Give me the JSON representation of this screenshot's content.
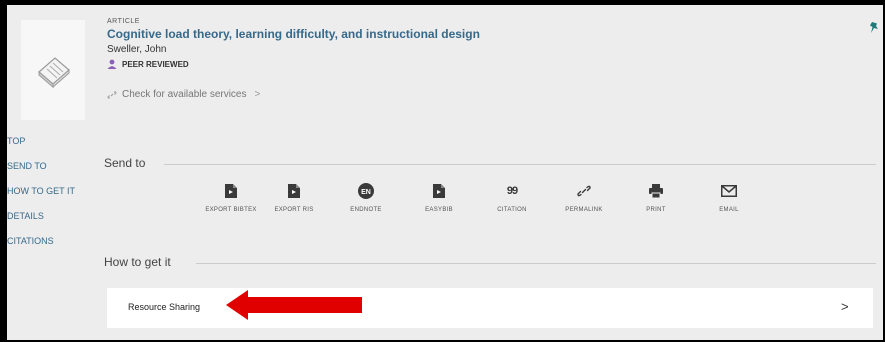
{
  "record": {
    "type": "ARTICLE",
    "title": "Cognitive load theory, learning difficulty, and instructional design",
    "author": "Sweller, John",
    "peer_reviewed": "PEER REVIEWED",
    "check_services": "Check for available services",
    "check_services_arrow": ">"
  },
  "sidenav": [
    "TOP",
    "SEND TO",
    "HOW TO GET IT",
    "DETAILS",
    "CITATIONS"
  ],
  "send_to": {
    "title": "Send to",
    "actions": [
      {
        "label": "EXPORT BIBTEX",
        "icon": "file-bibtex-icon"
      },
      {
        "label": "EXPORT RIS",
        "icon": "file-ris-icon"
      },
      {
        "label": "ENDNOTE",
        "icon": "endnote-icon",
        "badge": "EN"
      },
      {
        "label": "EASYBIB",
        "icon": "easybib-icon"
      },
      {
        "label": "CITATION",
        "icon": "quote-icon",
        "glyph": "99"
      },
      {
        "label": "PERMALINK",
        "icon": "link-icon"
      },
      {
        "label": "PRINT",
        "icon": "printer-icon"
      },
      {
        "label": "EMAIL",
        "icon": "envelope-icon"
      }
    ]
  },
  "how_to_get_it": {
    "title": "How to get it",
    "resource_sharing": "Resource Sharing",
    "chevron": ">"
  },
  "colors": {
    "link": "#37698a",
    "annotation_arrow": "#e00000",
    "background": "#ededed",
    "peer_badge": "#8a5fb5"
  }
}
